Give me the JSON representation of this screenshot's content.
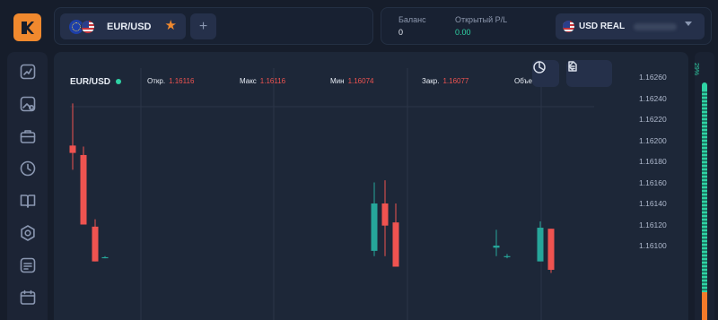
{
  "header": {
    "asset_tab": {
      "pair": "EUR/USD",
      "flag_left": "eu-flag",
      "flag_right": "us-flag",
      "favorite_icon": "star-icon",
      "favorite_color": "#f0892e"
    },
    "add_tab_icon": "plus-icon",
    "balance": {
      "label": "Баланс",
      "value": "0"
    },
    "open_pl": {
      "label": "Открытый P/L",
      "value": "0.00",
      "color": "#2fd3a5"
    },
    "account": {
      "name": "USD REAL",
      "flag": "us-flag",
      "dropdown_icon": "chevron-down-icon"
    }
  },
  "sidebar": {
    "items": [
      {
        "icon": "chart-icon"
      },
      {
        "icon": "image-icon"
      },
      {
        "icon": "briefcase-icon"
      },
      {
        "icon": "clock-icon"
      },
      {
        "icon": "book-icon"
      },
      {
        "icon": "settings-icon"
      },
      {
        "icon": "document-icon"
      },
      {
        "icon": "calendar-icon"
      }
    ]
  },
  "chart": {
    "pair": "EUR/USD",
    "live_indicator_color": "#2fd3a5",
    "ohlc": {
      "open_label": "Откр.",
      "open_value": "1.16116",
      "high_label": "Макс",
      "high_value": "1.16116",
      "low_label": "Мин",
      "low_value": "1.16074",
      "close_label": "Закр.",
      "close_value": "1.16077",
      "volume_label": "Объем"
    },
    "toolbar": {
      "indicators_icon": "pie-chart-icon",
      "back_icon": "chevron-left-icon",
      "drawing_icon": "document-edit-icon"
    },
    "colors": {
      "up": "#26a69a",
      "down": "#ef5350",
      "grid": "#2b3548",
      "background": "#1d2738"
    }
  },
  "chart_data": {
    "type": "candlestick",
    "ylim": [
      1.1609,
      1.1627
    ],
    "y_ticks": [
      "1.16260",
      "1.16240",
      "1.16220",
      "1.16200",
      "1.16180",
      "1.16160",
      "1.16140",
      "1.16120",
      "1.16100"
    ],
    "candles": [
      {
        "open": 1.16195,
        "close": 1.16188,
        "high": 1.16235,
        "low": 1.16172
      },
      {
        "open": 1.16186,
        "close": 1.1612,
        "high": 1.16194,
        "low": 1.1612
      },
      {
        "open": 1.16118,
        "close": 1.16085,
        "high": 1.16125,
        "low": 1.16085
      },
      {
        "open": 1.16088,
        "close": 1.16089,
        "high": 1.1609,
        "low": 1.16088
      },
      {
        "open": 1.16095,
        "close": 1.1614,
        "high": 1.1616,
        "low": 1.1609
      },
      {
        "open": 1.1614,
        "close": 1.16119,
        "high": 1.16162,
        "low": 1.1609
      },
      {
        "open": 1.16122,
        "close": 1.1608,
        "high": 1.1614,
        "low": 1.1608
      },
      {
        "open": 1.16098,
        "close": 1.161,
        "high": 1.16115,
        "low": 1.1609
      },
      {
        "open": 1.16089,
        "close": 1.1609,
        "high": 1.16092,
        "low": 1.16088
      },
      {
        "open": 1.16085,
        "close": 1.16117,
        "high": 1.16123,
        "low": 1.16085
      },
      {
        "open": 1.16116,
        "close": 1.16077,
        "high": 1.16116,
        "low": 1.16074
      }
    ]
  },
  "right_bar": {
    "percent": "29%",
    "up_color": "#2fd3a5",
    "down_color": "#f47a2a"
  }
}
